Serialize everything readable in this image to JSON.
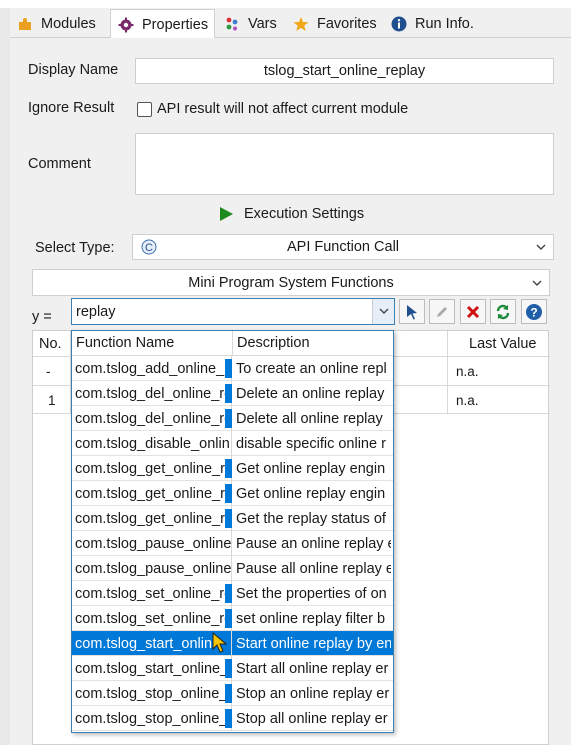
{
  "tabs": [
    {
      "label": "Modules",
      "icon": "puzzle-icon",
      "active": false
    },
    {
      "label": "Properties",
      "icon": "gear-icon",
      "active": true
    },
    {
      "label": "Vars",
      "icon": "vars-icon",
      "active": false
    },
    {
      "label": "Favorites",
      "icon": "star-icon",
      "active": false
    },
    {
      "label": "Run Info.",
      "icon": "info-icon",
      "active": false
    }
  ],
  "form": {
    "display_name_label": "Display Name",
    "display_name_value": "tslog_start_online_replay",
    "ignore_result_label": "Ignore Result",
    "ignore_result_checkbox_text": "API result will not affect current module",
    "comment_label": "Comment",
    "comment_value": "",
    "execution_settings_label": "Execution Settings",
    "select_type_label": "Select Type:",
    "select_type_value": "API Function Call",
    "category_value": "Mini Program System Functions",
    "assign_label": "y =",
    "function_search_value": "replay"
  },
  "params_table": {
    "headers": [
      "No.",
      "Last Value"
    ],
    "rows": [
      {
        "no": "-",
        "last_value": "n.a."
      },
      {
        "no": "1",
        "last_value": "n.a."
      }
    ]
  },
  "dropdown": {
    "headers": {
      "function": "Function Name",
      "description": "Description"
    },
    "selected_index": 11,
    "rows": [
      {
        "fn": "com.tslog_add_online_r",
        "desc": "To create an online repl",
        "hl": true
      },
      {
        "fn": "com.tslog_del_online_re",
        "desc": "Delete an online replay",
        "hl": true
      },
      {
        "fn": "com.tslog_del_online_re",
        "desc": "Delete all online replay",
        "hl": true
      },
      {
        "fn": "com.tslog_disable_onlin",
        "desc": "disable specific online r",
        "hl": false
      },
      {
        "fn": "com.tslog_get_online_re",
        "desc": "Get online replay engin",
        "hl": true
      },
      {
        "fn": "com.tslog_get_online_re",
        "desc": "Get online replay engin",
        "hl": true
      },
      {
        "fn": "com.tslog_get_online_re",
        "desc": "Get the replay status of",
        "hl": true
      },
      {
        "fn": "com.tslog_pause_online",
        "desc": "Pause an online replay e",
        "hl": false
      },
      {
        "fn": "com.tslog_pause_online",
        "desc": "Pause all online replay e",
        "hl": false
      },
      {
        "fn": "com.tslog_set_online_re",
        "desc": "Set the properties of on",
        "hl": true
      },
      {
        "fn": "com.tslog_set_online_re",
        "desc": "set online replay filter b",
        "hl": true
      },
      {
        "fn": "com.tslog_start_onlin",
        "desc": "Start online replay by en",
        "hl": false
      },
      {
        "fn": "com.tslog_start_online_",
        "desc": "Start all online replay er",
        "hl": true
      },
      {
        "fn": "com.tslog_stop_online_",
        "desc": "Stop an online replay er",
        "hl": true
      },
      {
        "fn": "com.tslog_stop_online_",
        "desc": "Stop all online replay er",
        "hl": true
      }
    ]
  },
  "colors": {
    "accent": "#0078d7",
    "play": "#1e8a1e",
    "delete": "#d01010",
    "refresh": "#1a8a3a",
    "help": "#1f5fa8"
  }
}
